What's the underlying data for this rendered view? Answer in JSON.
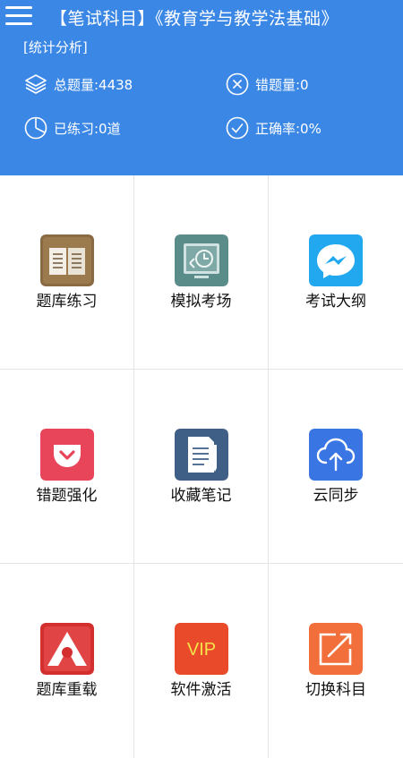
{
  "header": {
    "title": "【笔试科目】《教育学与教学法基础》",
    "section_label": "[统计分析]",
    "stats": {
      "total": "总题量:4438",
      "wrong": "错题量:0",
      "practiced": "已练习:0道",
      "accuracy": "正确率:0%"
    }
  },
  "grid": {
    "items": [
      {
        "label": "题库练习",
        "icon": "book-icon",
        "color": "#8a6a42"
      },
      {
        "label": "模拟考场",
        "icon": "clock-screen-icon",
        "color": "#5a8c8a"
      },
      {
        "label": "考试大纲",
        "icon": "messenger-icon",
        "color": "#22a8ef"
      },
      {
        "label": "错题强化",
        "icon": "pocket-icon",
        "color": "#e9455a"
      },
      {
        "label": "收藏笔记",
        "icon": "document-pen-icon",
        "color": "#3f5f86"
      },
      {
        "label": "云同步",
        "icon": "cloud-upload-icon",
        "color": "#3a75e4"
      },
      {
        "label": "题库重载",
        "icon": "air-icon",
        "color": "#d32f2f"
      },
      {
        "label": "软件激活",
        "icon": "vip-icon",
        "color": "#e84a2a",
        "text": "VIP"
      },
      {
        "label": "切换科目",
        "icon": "share-out-icon",
        "color": "#f26f3b"
      }
    ]
  }
}
